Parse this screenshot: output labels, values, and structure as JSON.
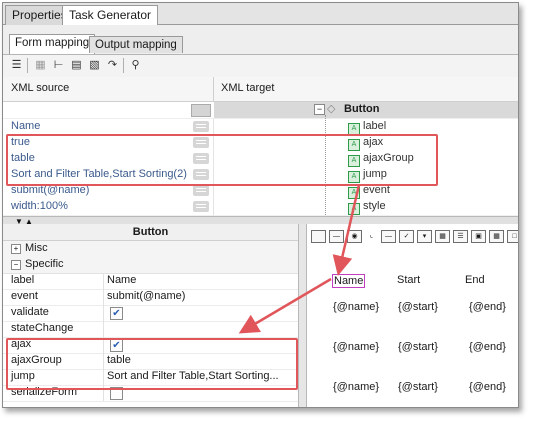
{
  "top_tabs": [
    "Properties",
    "Task Generator"
  ],
  "sub_tabs": [
    "Form mapping",
    "Output mapping"
  ],
  "toolbar_icons": [
    "list-icon",
    "grid-icon",
    "tree-icon",
    "document-icon",
    "document-ref-icon",
    "document-arrow-icon",
    "search-icon"
  ],
  "grid": {
    "col_source": "XML source",
    "col_target": "XML target",
    "root_node": "Button",
    "rows": [
      {
        "source": "Name",
        "target": "label"
      },
      {
        "source": "true",
        "target": "ajax"
      },
      {
        "source": "table",
        "target": "ajaxGroup"
      },
      {
        "source": "Sort and Filter Table,Start Sorting(2)",
        "target": "jump"
      },
      {
        "source": "submit(@name)",
        "target": "event"
      },
      {
        "source": "width:100%",
        "target": "style"
      }
    ]
  },
  "props": {
    "title": "Button",
    "section_misc": "Misc",
    "section_specific": "Specific",
    "rows": [
      {
        "key": "label",
        "value": "Name"
      },
      {
        "key": "event",
        "value": "submit(@name)"
      },
      {
        "key": "validate",
        "value": "",
        "checked": true
      },
      {
        "key": "stateChange",
        "value": ""
      },
      {
        "key": "ajax",
        "value": "",
        "checked": true
      },
      {
        "key": "ajaxGroup",
        "value": "table"
      },
      {
        "key": "jump",
        "value": "Sort and Filter Table,Start Sorting..."
      },
      {
        "key": "serializeForm",
        "value": "",
        "checked": false
      }
    ]
  },
  "preview": {
    "headers": [
      "Name",
      "Start",
      "End"
    ],
    "row_cells": [
      "{@name}",
      "{@start}",
      "{@end}"
    ]
  },
  "colors": {
    "highlight": "#e0565b",
    "link_text": "#3a5a8c"
  }
}
